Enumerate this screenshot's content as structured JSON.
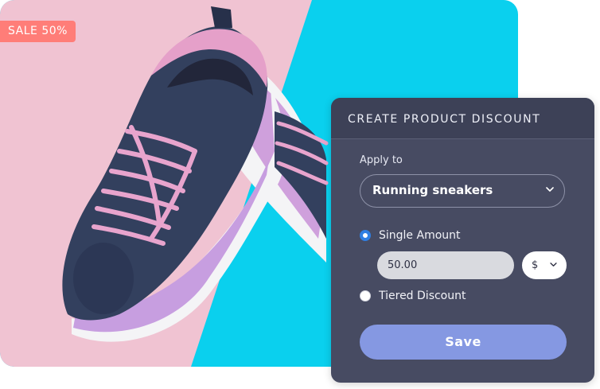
{
  "badge": {
    "text": "SALE 50%"
  },
  "panel": {
    "title": "CREATE PRODUCT DISCOUNT",
    "apply_to_label": "Apply to",
    "product_select": {
      "value": "Running sneakers"
    },
    "options": [
      {
        "label": "Single Amount",
        "checked": true
      },
      {
        "label": "Tiered Discount",
        "checked": false
      }
    ],
    "amount_input": {
      "value": "50.00"
    },
    "currency_select": {
      "value": "$"
    },
    "save_label": "Save"
  },
  "colors": {
    "panel_bg": "#474b62",
    "header_bg": "#3d4157",
    "save_button": "#8598e2",
    "radio_selected": "#2f7fe3",
    "badge_bg": "#ff7d78",
    "photo_pink": "#f0c3d2",
    "photo_blue": "#0ad0ee"
  },
  "icons": [
    "chevron-down-icon",
    "radio-selected-icon",
    "radio-unselected-icon"
  ]
}
